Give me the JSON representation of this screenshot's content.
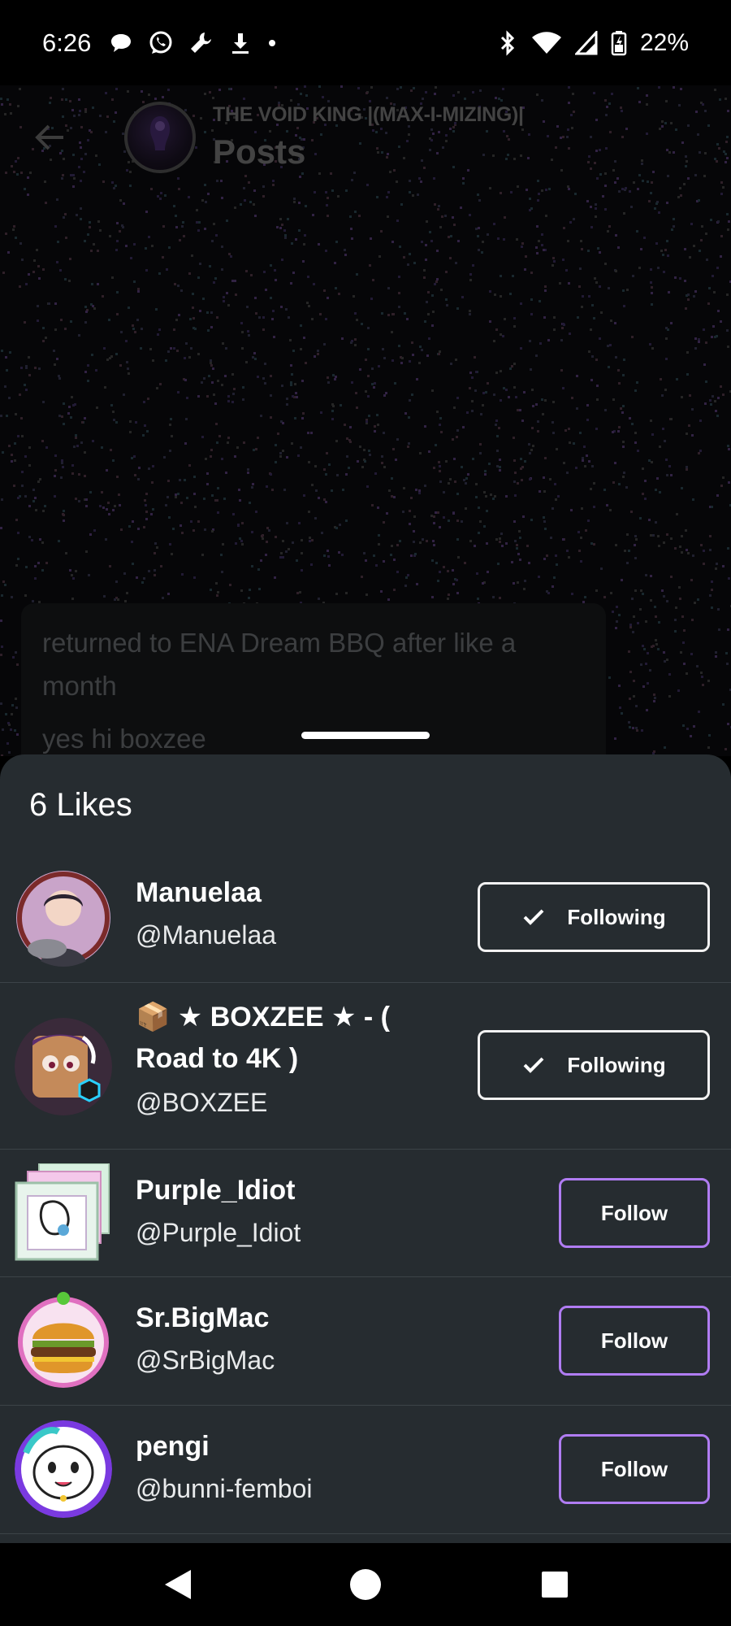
{
  "status_bar": {
    "time": "6:26",
    "battery": "22%",
    "icons": [
      "chat-bubble-icon",
      "whatsapp-icon",
      "wrench-icon",
      "download-icon",
      "dot-icon",
      "bluetooth-icon",
      "wifi-icon",
      "signal-icon",
      "battery-icon"
    ]
  },
  "header": {
    "blog_name": "THE VOID KING |(MAX-I-MIZING)|",
    "section": "Posts"
  },
  "post": {
    "text_line": "returned to ENA Dream BBQ after like a month",
    "text_line_2": "yes hi boxzee"
  },
  "likes_sheet": {
    "title": "6 Likes",
    "items": [
      {
        "name": "Manuelaa",
        "handle": "@Manuelaa",
        "button": "Following",
        "following": true
      },
      {
        "name": "📦 ★ BOXZEE ★ - ( Road to 4K )",
        "handle": "@BOXZEE",
        "button": "Following",
        "following": true
      },
      {
        "name": "Purple_Idiot",
        "handle": "@Purple_Idiot",
        "button": "Follow",
        "following": false
      },
      {
        "name": "Sr.BigMac",
        "handle": "@SrBigMac",
        "button": "Follow",
        "following": false
      },
      {
        "name": "pengi",
        "handle": "@bunni-femboi",
        "button": "Follow",
        "following": false
      }
    ]
  },
  "colors": {
    "sheet_bg": "#262c30",
    "follow_accent": "#b07cf2",
    "following_border": "#f2f2f2"
  }
}
